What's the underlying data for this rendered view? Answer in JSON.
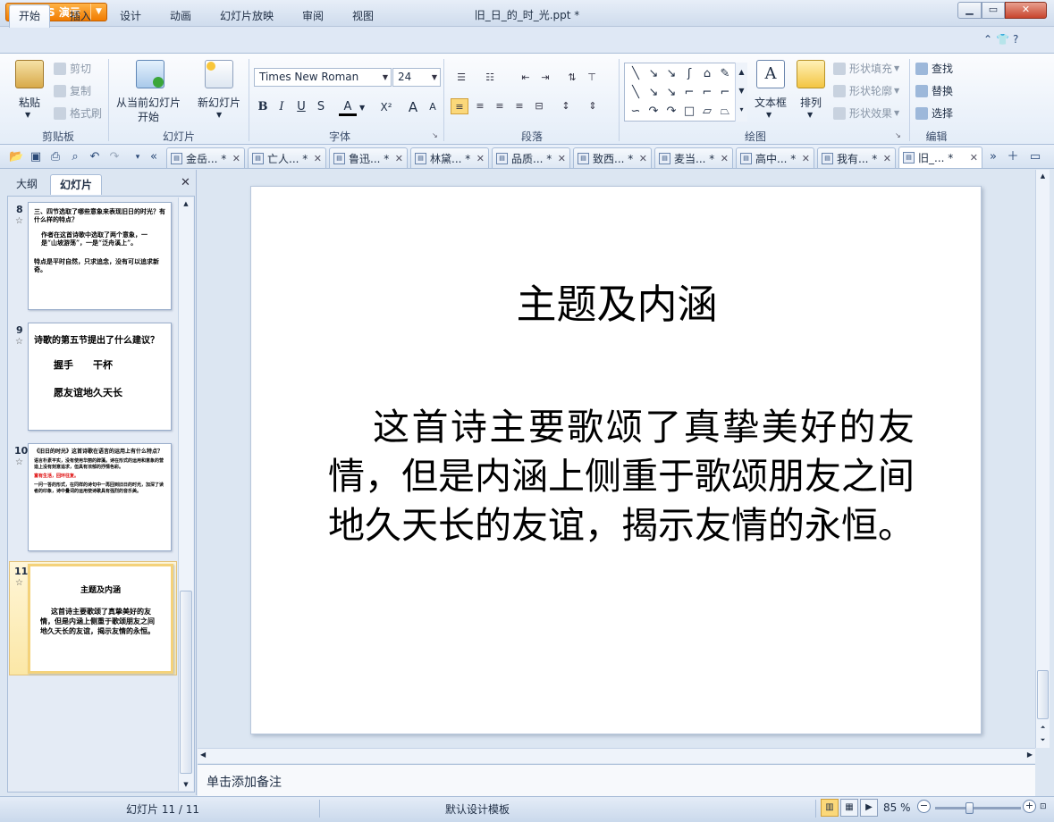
{
  "app": {
    "name": "WPS 演示",
    "doc_title": "旧_日_的_时_光.ppt *"
  },
  "menu": {
    "tabs": [
      "开始",
      "插入",
      "设计",
      "动画",
      "幻灯片放映",
      "审阅",
      "视图"
    ],
    "active": "开始"
  },
  "ribbon": {
    "clipboard": {
      "paste": "粘贴",
      "cut": "剪切",
      "copy": "复制",
      "format_painter": "格式刷",
      "group": "剪贴板"
    },
    "slides": {
      "from_current_line1": "从当前幻灯片",
      "from_current_line2": "开始",
      "new_slide": "新幻灯片",
      "group": "幻灯片"
    },
    "font": {
      "name": "Times New Roman",
      "size": "24",
      "bold": "B",
      "italic": "I",
      "underline": "U",
      "shadow": "S",
      "color": "A",
      "superscript": "X²",
      "grow": "A",
      "shrink": "A",
      "group": "字体"
    },
    "paragraph": {
      "group": "段落"
    },
    "drawing": {
      "textbox": "文本框",
      "arrange": "排列",
      "shape_fill": "形状填充",
      "shape_outline": "形状轮廓",
      "shape_effect": "形状效果",
      "group": "绘图"
    },
    "editing": {
      "find": "查找",
      "replace": "替换",
      "select": "选择",
      "group": "编辑"
    }
  },
  "doc_tabs": [
    {
      "label": "金岳... *"
    },
    {
      "label": "亡人... *"
    },
    {
      "label": "鲁迅... *"
    },
    {
      "label": "林黛... *"
    },
    {
      "label": "品质... *"
    },
    {
      "label": "致西... *"
    },
    {
      "label": "麦当... *"
    },
    {
      "label": "高中... *"
    },
    {
      "label": "我有... *"
    },
    {
      "label": "旧_... *"
    }
  ],
  "left_panel": {
    "tabs": [
      "大纲",
      "幻灯片"
    ],
    "active_tab": "幻灯片",
    "slides": [
      {
        "num": "8",
        "lines": [
          "三、四节选取了哪些意象来表现旧日的时光？有什么样的特点？",
          "作者在这首诗歌中选取了两个意象，一是“山坡游荡”，一是“泛舟溪上”。",
          "特点是平时自然，只求追念，没有可以追求新奇。"
        ]
      },
      {
        "num": "9",
        "lines": [
          "诗歌的第五节提出了什么建议？",
          "握手　　干杯",
          "愿友谊地久天长"
        ]
      },
      {
        "num": "10",
        "lines": [
          "《旧日的时光》这首诗歌在语言的运用上有什么特点？",
          "语言朴素平实，没有使用华丽的辞藻。诗在形式的运用和意象的营造上没有刻意追求，但具有浓郁的抒情色彩。",
          "富有生活，回环往复。",
          "一问一答的形式，在同样的诗句中一再回到旧日的时光，加深了读者的印象，诗中叠词的运用使诗歌具有强烈的音乐美。"
        ]
      },
      {
        "num": "11",
        "lines": [
          "主题及内涵",
          "这首诗主要歌颂了真挚美好的友情，但是内涵上侧重于歌颂朋友之间地久天长的友谊，揭示友情的永恒。"
        ]
      }
    ],
    "selected_slide": "11"
  },
  "slide": {
    "title": "主题及内涵",
    "body": "这首诗主要歌颂了真挚美好的友情，但是内涵上侧重于歌颂朋友之间地久天长的友谊，揭示友情的永恒。"
  },
  "notes": {
    "placeholder": "单击添加备注"
  },
  "status": {
    "slide_counter": "幻灯片 11 / 11",
    "template": "默认设计模板",
    "zoom": "85 %"
  },
  "colors": {
    "accent": "#f07b00",
    "chrome": "#dce6f2",
    "selected_thumb": "#f4d27a"
  }
}
